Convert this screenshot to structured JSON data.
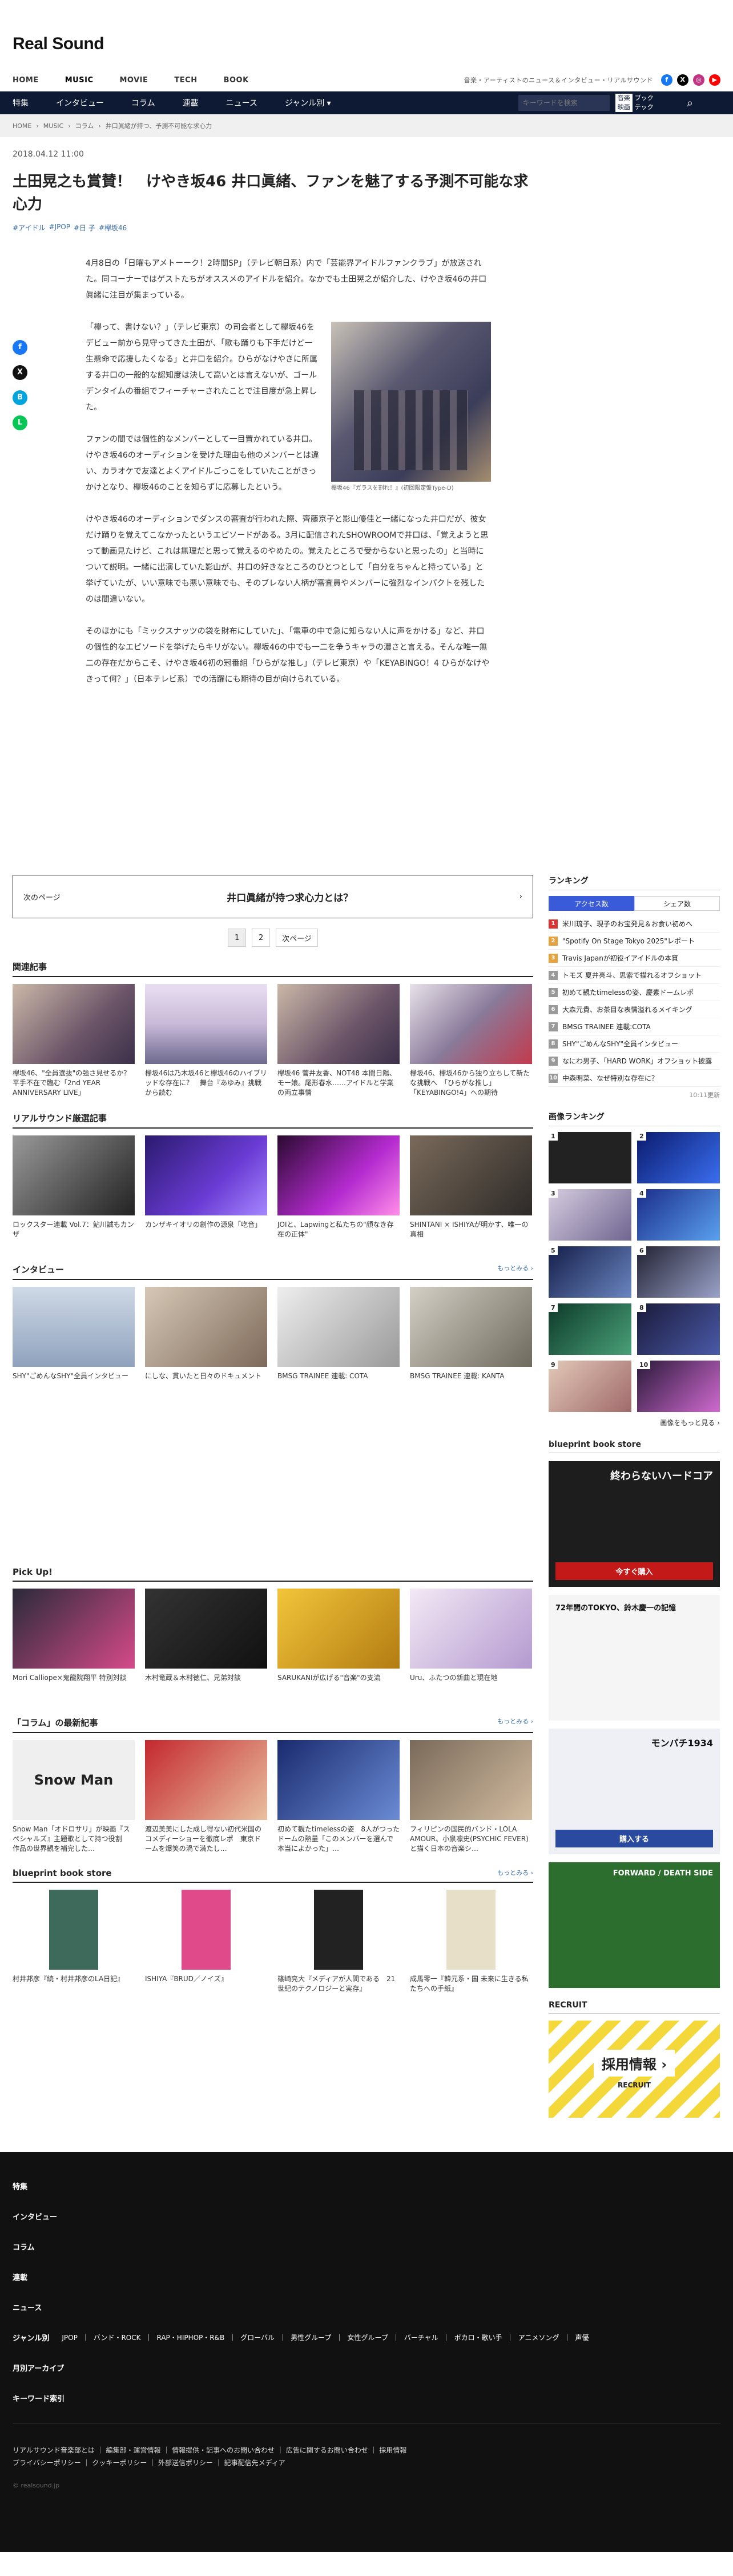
{
  "site": {
    "logo": "Real Sound",
    "nav": [
      "HOME",
      "MUSIC",
      "MOVIE",
      "TECH",
      "BOOK"
    ],
    "tagline": "音楽・アーティストのニュース＆インタビュー・リアルサウンド",
    "subnav": [
      "特集",
      "インタビュー",
      "コラム",
      "連載",
      "ニュース",
      "ジャンル別 ▾"
    ],
    "search_placeholder": "キーワードを検索",
    "search_opts": [
      "音楽",
      "ブック",
      "映画",
      "テック"
    ]
  },
  "breadcrumb": [
    "HOME",
    "MUSIC",
    "コラム",
    "井口眞緒が持つ、予測不可能な求心力"
  ],
  "article": {
    "date": "2018.04.12 11:00",
    "title": "土田晃之も賞賛！　けやき坂46 井口眞緒、ファンを魅了する予測不可能な求心力",
    "tags": [
      "#アイドル",
      "#JPOP",
      "#日 子",
      "#欅坂46"
    ],
    "p1": "4月8日の「日曜もアメトーーク！2時間SP」（テレビ朝日系）内で「芸能界アイドルファンクラブ」が放送された。同コーナーではゲストたちがオススメのアイドルを紹介。なかでも土田晃之が紹介した、けやき坂46の井口眞緒に注目が集まっている。",
    "p2": "「欅って、書けない？」（テレビ東京）の司会者として欅坂46をデビュー前から見守ってきた土田が、「歌も踊りも下手だけど一生懸命で応援したくなる」と井口を紹介。ひらがなけやきに所属する井口の一般的な認知度は決して高いとは言えないが、ゴールデンタイムの番組でフィーチャーされたことで注目度が急上昇した。",
    "p3": "ファンの間では個性的なメンバーとして一目置かれている井口。けやき坂46のオーディションを受けた理由も他のメンバーとは違い、カラオケで友達とよくアイドルごっこをしていたことがきっかけとなり、欅坂46のことを知らずに応募したという。",
    "p4": "けやき坂46のオーディションでダンスの審査が行われた際、齊藤京子と影山優佳と一緒になった井口だが、彼女だけ踊りを覚えてこなかったというエピソードがある。3月に配信されたSHOWROOMで井口は、「覚えようと思って動画見たけど、これは無理だと思って覚えるのやめたの。覚えたところで受からないと思ったの」と当時について説明。一緒に出演していた影山が、井口の好きなところのひとつとして「自分をちゃんと持っている」と挙げていたが、いい意味でも悪い意味でも、そのブレない人柄が審査員やメンバーに強烈なインパクトを残したのは間違いない。",
    "p5": "そのほかにも「ミックスナッツの袋を財布にしていた」、「電車の中で急に知らない人に声をかける」など、井口の個性的なエピソードを挙げたらキリがない。欅坂46の中でも一二を争うキャラの濃さと言える。そんな唯一無二の存在だからこそ、けやき坂46初の冠番組「ひらがな推し」（テレビ東京）や「KEYABINGO！4 ひらがなけやきって何？」（日本テレビ系）での活躍にも期待の目が向けられている。",
    "caption": "欅坂46『ガラスを割れ！』(初回限定盤Type-D)"
  },
  "next": {
    "label": "次のページ",
    "title": "井口眞緒が持つ求心力とは？"
  },
  "pager": [
    "1",
    "2",
    "次ページ"
  ],
  "related": {
    "heading": "関連記事",
    "items": [
      "欅坂46、\"全員選抜\"の強さ見せるか？　平手不在で臨む「2nd YEAR ANNIVERSARY LIVE」",
      "欅坂46は乃木坂46と欅坂46のハイブリッドな存在に？　舞台『あゆみ』挑戦から読む",
      "欅坂46 菅井友香、NOT48 本間日陽、モー娘。尾形春水……アイドルと学業の両立事情",
      "欅坂46、欅坂46から独り立ちして新たな挑戦へ　「ひらがな推し」「KEYABINGO!4」への期待"
    ]
  },
  "recommend": {
    "heading": "リアルサウンド厳選記事",
    "items": [
      "ロックスター連載 Vol.7：鮎川誠もカンザ",
      "カンザキイオリの創作の源泉「吃音」",
      "JOIと、Lapwingと私たちの\"顔なき存在の正体\"",
      "SHINTANI × ISHIYAが明かす、唯一の真相"
    ]
  },
  "interview": {
    "heading": "インタビュー",
    "more": "もっとみる ›",
    "items": [
      "SHY\"ごめんなSHY\"全員インタビュー",
      "にしな、貫いたと日々のドキュメント",
      "BMSG TRAINEE 連載: COTA",
      "BMSG TRAINEE 連載: KANTA"
    ]
  },
  "pickup": {
    "heading": "Pick Up!",
    "items": [
      "Mori Calliope×鬼龍院翔平 特別対談",
      "木村竜蔵＆木村徳仁、兄弟対談",
      "SARUKANIが広げる\"音楽\"の支流",
      "Uru、ふたつの新曲と現在地"
    ]
  },
  "column": {
    "heading": "「コラム」の最新記事",
    "more": "もっとみる ›",
    "items": [
      "Snow Man「オドロサリ」が映画『スペシャルズ』主題歌として持つ役割　作品の世界観を補完した…",
      "渡辺美美にした成し得ない初代米国のコメディーショーを徹底レポ　東京ドームを爆笑の渦で満たし…",
      "初めて観たtimelessの姿　8人がつったドームの熱量「このメンバーを選んで本当によかった」…",
      "フィリピンの国民的バンド・LOLA AMOUR、小泉凛史(PSYCHIC FEVER)と描く日本の音楽シ…"
    ],
    "snowman": "Snow Man"
  },
  "books": {
    "heading": "blueprint book store",
    "more": "もっとみる ›",
    "items": [
      "村井邦彦『続・村井邦彦のLA日記』",
      "ISHIYA『BRUD／ノイズ』",
      "篠崎亮大『メディアが人間である　21世紀のテクノロジーと実存』",
      "成馬零一『韓元系・国 未来に生きる私たちへの手紙』"
    ]
  },
  "ranking": {
    "heading": "ランキング",
    "tabs": [
      "アクセス数",
      "シェア数"
    ],
    "items": [
      "米川琉子、現子のお宝発見＆お食い初めへ",
      "\"Spotify On Stage Tokyo 2025\"レポート",
      "Travis Japanが初役イアイドルの本質",
      "トモズ 夏井亮斗、思索で描れるオフショット",
      "初めて観たtimelessの姿、慶素ドームレポ",
      "大森元貴、お茶目な表情溢れるメイキング",
      "BMSG TRAINEE 連載:COTA",
      "SHY\"ごめんなSHY\"全員インタビュー",
      "なにわ男子、「HARD WORK」オフショット披露",
      "中森明菜、なぜ特別な存在に？"
    ],
    "updated": "10:11更新"
  },
  "image_ranking": {
    "heading": "画像ランキング",
    "labels": [
      "1",
      "2",
      "3",
      "4",
      "5",
      "6",
      "7",
      "8",
      "9",
      "10"
    ],
    "more": "画像をもっと見る ›"
  },
  "book_ads": {
    "heading": "blueprint book store",
    "ad1_title": "終わらないハードコア",
    "ad1_btn": "今すぐ購入",
    "ad2_title": "72年間のTOKYO、鈴木慶一の記憶",
    "ad3_title": "モンパチ1934",
    "ad3_btn": "購入する",
    "ad4_title": "FORWARD / DEATH SIDE"
  },
  "recruit": {
    "heading": "RECRUIT",
    "title": "採用情報 ›",
    "sub": "RECRUIT"
  },
  "footer": {
    "items": [
      "特集",
      "インタビュー",
      "コラム",
      "連載",
      "ニュース"
    ],
    "genre_label": "ジャンル別",
    "genres": [
      "JPOP",
      "バンド・ROCK",
      "RAP・HIPHOP・R&B",
      "グローバル",
      "男性グループ",
      "女性グループ",
      "バーチャル",
      "ボカロ・歌い手",
      "アニメソング",
      "声優"
    ],
    "archive": "月別アーカイブ",
    "keyword": "キーワード索引",
    "links": "リアルサウンド音楽部とは ｜ 編集部・運営情報 ｜ 情報提供・記事へのお問い合わせ ｜ 広告に関するお問い合わせ ｜ 採用情報",
    "links2": "プライバシーポリシー ｜ クッキーポリシー ｜ 外部送信ポリシー ｜ 記事配信先メディア",
    "copy": "© realsound.jp"
  }
}
